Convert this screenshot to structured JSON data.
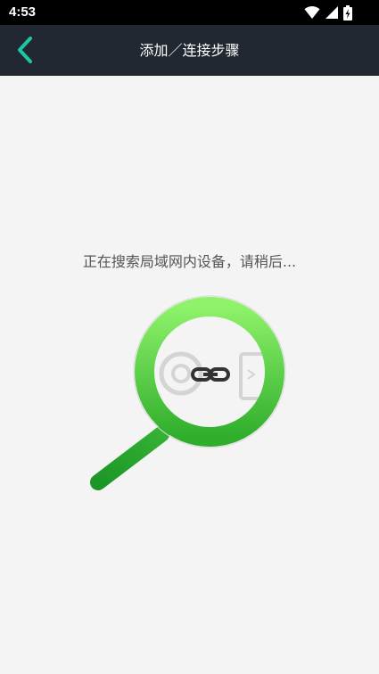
{
  "status_bar": {
    "time": "4:53",
    "icons": [
      "wifi-icon",
      "signal-icon",
      "battery-charging-icon"
    ]
  },
  "app_bar": {
    "back_icon": "chevron-left-icon",
    "title": "添加／连接步骤"
  },
  "main": {
    "searching_text": "正在搜索局域网内设备，请稍后...",
    "illustration_icon": "magnifier-search-icon",
    "center_icon": "link-chain-icon"
  },
  "colors": {
    "status_bar_bg": "#000000",
    "app_bar_bg": "#222831",
    "accent_teal": "#1ec7a4",
    "page_bg": "#f4f4f4",
    "magnifier_green": "#4cc94a",
    "text_gray": "#555555"
  }
}
